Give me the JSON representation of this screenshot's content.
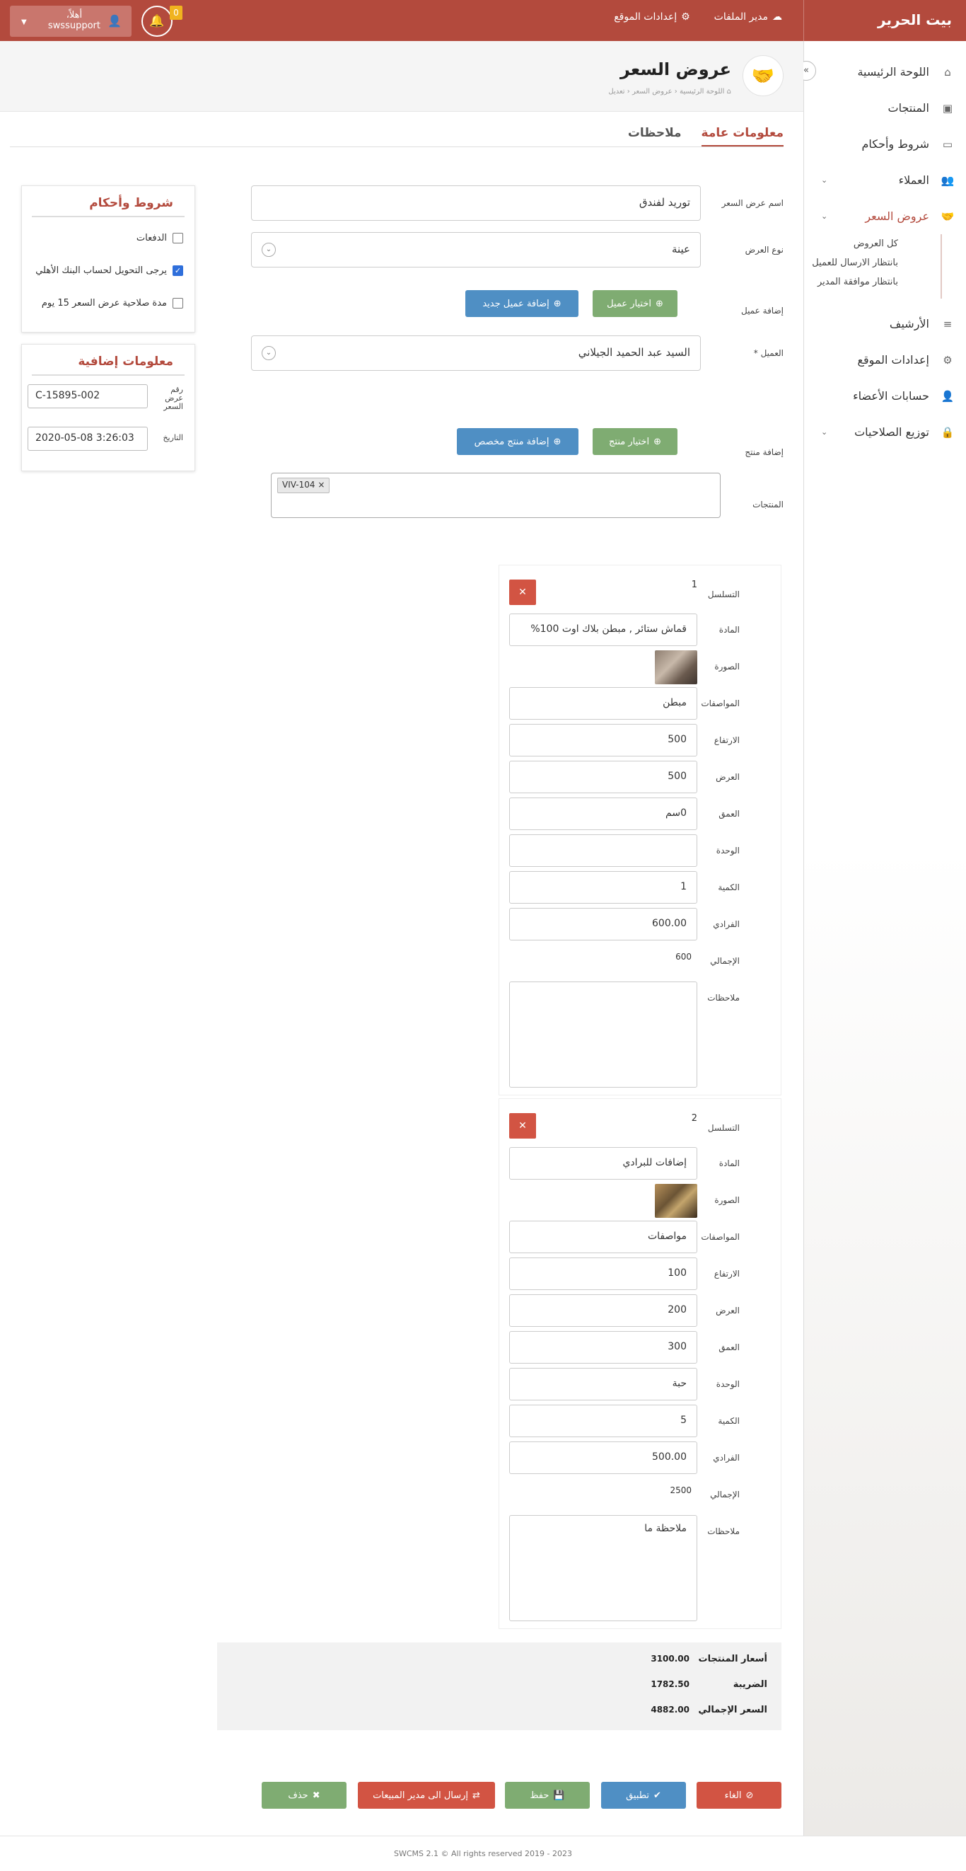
{
  "topbar": {
    "brand": "بيت الحرير",
    "file_manager": "مدير الملفات",
    "site_settings": "إعدادات الموقع",
    "notification_count": "0",
    "user_greeting": "أهلاً،",
    "username": "swssupport"
  },
  "sidebar": {
    "items": [
      {
        "label": "اللوحة الرئيسية",
        "icon": "home-icon"
      },
      {
        "label": "المنتجات",
        "icon": "box-icon"
      },
      {
        "label": "شروط وأحكام",
        "icon": "card-icon"
      },
      {
        "label": "العملاء",
        "icon": "users-icon"
      },
      {
        "label": "عروض السعر",
        "icon": "handshake-icon"
      },
      {
        "label": "الأرشيف",
        "icon": "list-icon"
      },
      {
        "label": "إعدادات الموقع",
        "icon": "gear-icon"
      },
      {
        "label": "حسابات الأعضاء",
        "icon": "user-icon"
      },
      {
        "label": "توزيع الصلاحيات",
        "icon": "lock-icon"
      }
    ],
    "sub_items": [
      "كل العروض",
      "بانتظار الارسال للعميل",
      "بانتظار موافقة المدير"
    ]
  },
  "page": {
    "title": "عروض السعر",
    "breadcrumb": [
      "اللوحة الرئيسية",
      "عروض السعر",
      "تعديل"
    ]
  },
  "tabs": [
    "معلومات عامة",
    "ملاحظات"
  ],
  "form": {
    "offer_name_label": "اسم عرض السعر",
    "offer_name_value": "توريد لفندق",
    "offer_type_label": "نوع العرض",
    "offer_type_value": "عينة",
    "add_client_label": "إضافة عميل",
    "choose_client_btn": "اختيار عميل",
    "add_new_client_btn": "إضافة عميل جديد",
    "client_label": "العميل *",
    "client_value": "السيد عبد الحميد الجيلاني",
    "add_product_label": "إضافة منتج",
    "choose_product_btn": "اختيار منتج",
    "add_custom_product_btn": "إضافة منتج مخصص",
    "products_label": "المنتجات",
    "product_tag": "VIV-104"
  },
  "terms_panel": {
    "title": "شروط وأحكام",
    "options": [
      {
        "label": "الدفعات",
        "checked": false
      },
      {
        "label": "يرجى التحويل لحساب البنك الأهلي",
        "checked": true
      },
      {
        "label": "مدة صلاحية عرض السعر 15 يوم",
        "checked": false
      }
    ]
  },
  "extra_panel": {
    "title": "معلومات إضافية",
    "offer_number_label": "رقم عرض السعر",
    "offer_number_value": "C-15895-002",
    "date_label": "التاريخ",
    "date_value": "2020-05-08 3:26:03"
  },
  "item_labels": {
    "serial": "التسلسل",
    "material": "المادة",
    "image": "الصورة",
    "specs": "المواصفات",
    "height": "الارتفاع",
    "width": "العرض",
    "depth": "العمق",
    "unit": "الوحدة",
    "quantity": "الكمية",
    "unit_price": "الفرادي",
    "total": "الإجمالي",
    "notes": "ملاحظات"
  },
  "items": [
    {
      "serial": "1",
      "material": "قماش ستائر , مبطن بلاك اوت 100%",
      "specs": "مبطن",
      "height": "500",
      "width": "500",
      "depth": "0سم",
      "unit": "",
      "quantity": "1",
      "unit_price": "600.00",
      "total": "600",
      "notes": ""
    },
    {
      "serial": "2",
      "material": "إضافات للبرادي",
      "specs": "مواصفات",
      "height": "100",
      "width": "200",
      "depth": "300",
      "unit": "حبة",
      "quantity": "5",
      "unit_price": "500.00",
      "total": "2500",
      "notes": "ملاحظة ما"
    }
  ],
  "totals": {
    "products_label": "أسعار المنتجات",
    "products_value": "3100.00",
    "tax_label": "الضريبة",
    "tax_value": "1782.50",
    "grand_label": "السعر الإجمالي",
    "grand_value": "4882.00"
  },
  "actions": {
    "cancel": "الغاء",
    "apply": "تطبيق",
    "save": "حفظ",
    "send": "إرسال الى مدير المبيعات",
    "delete": "حذف"
  },
  "footer": "SWCMS 2.1 © All rights reserved 2019 - 2023"
}
